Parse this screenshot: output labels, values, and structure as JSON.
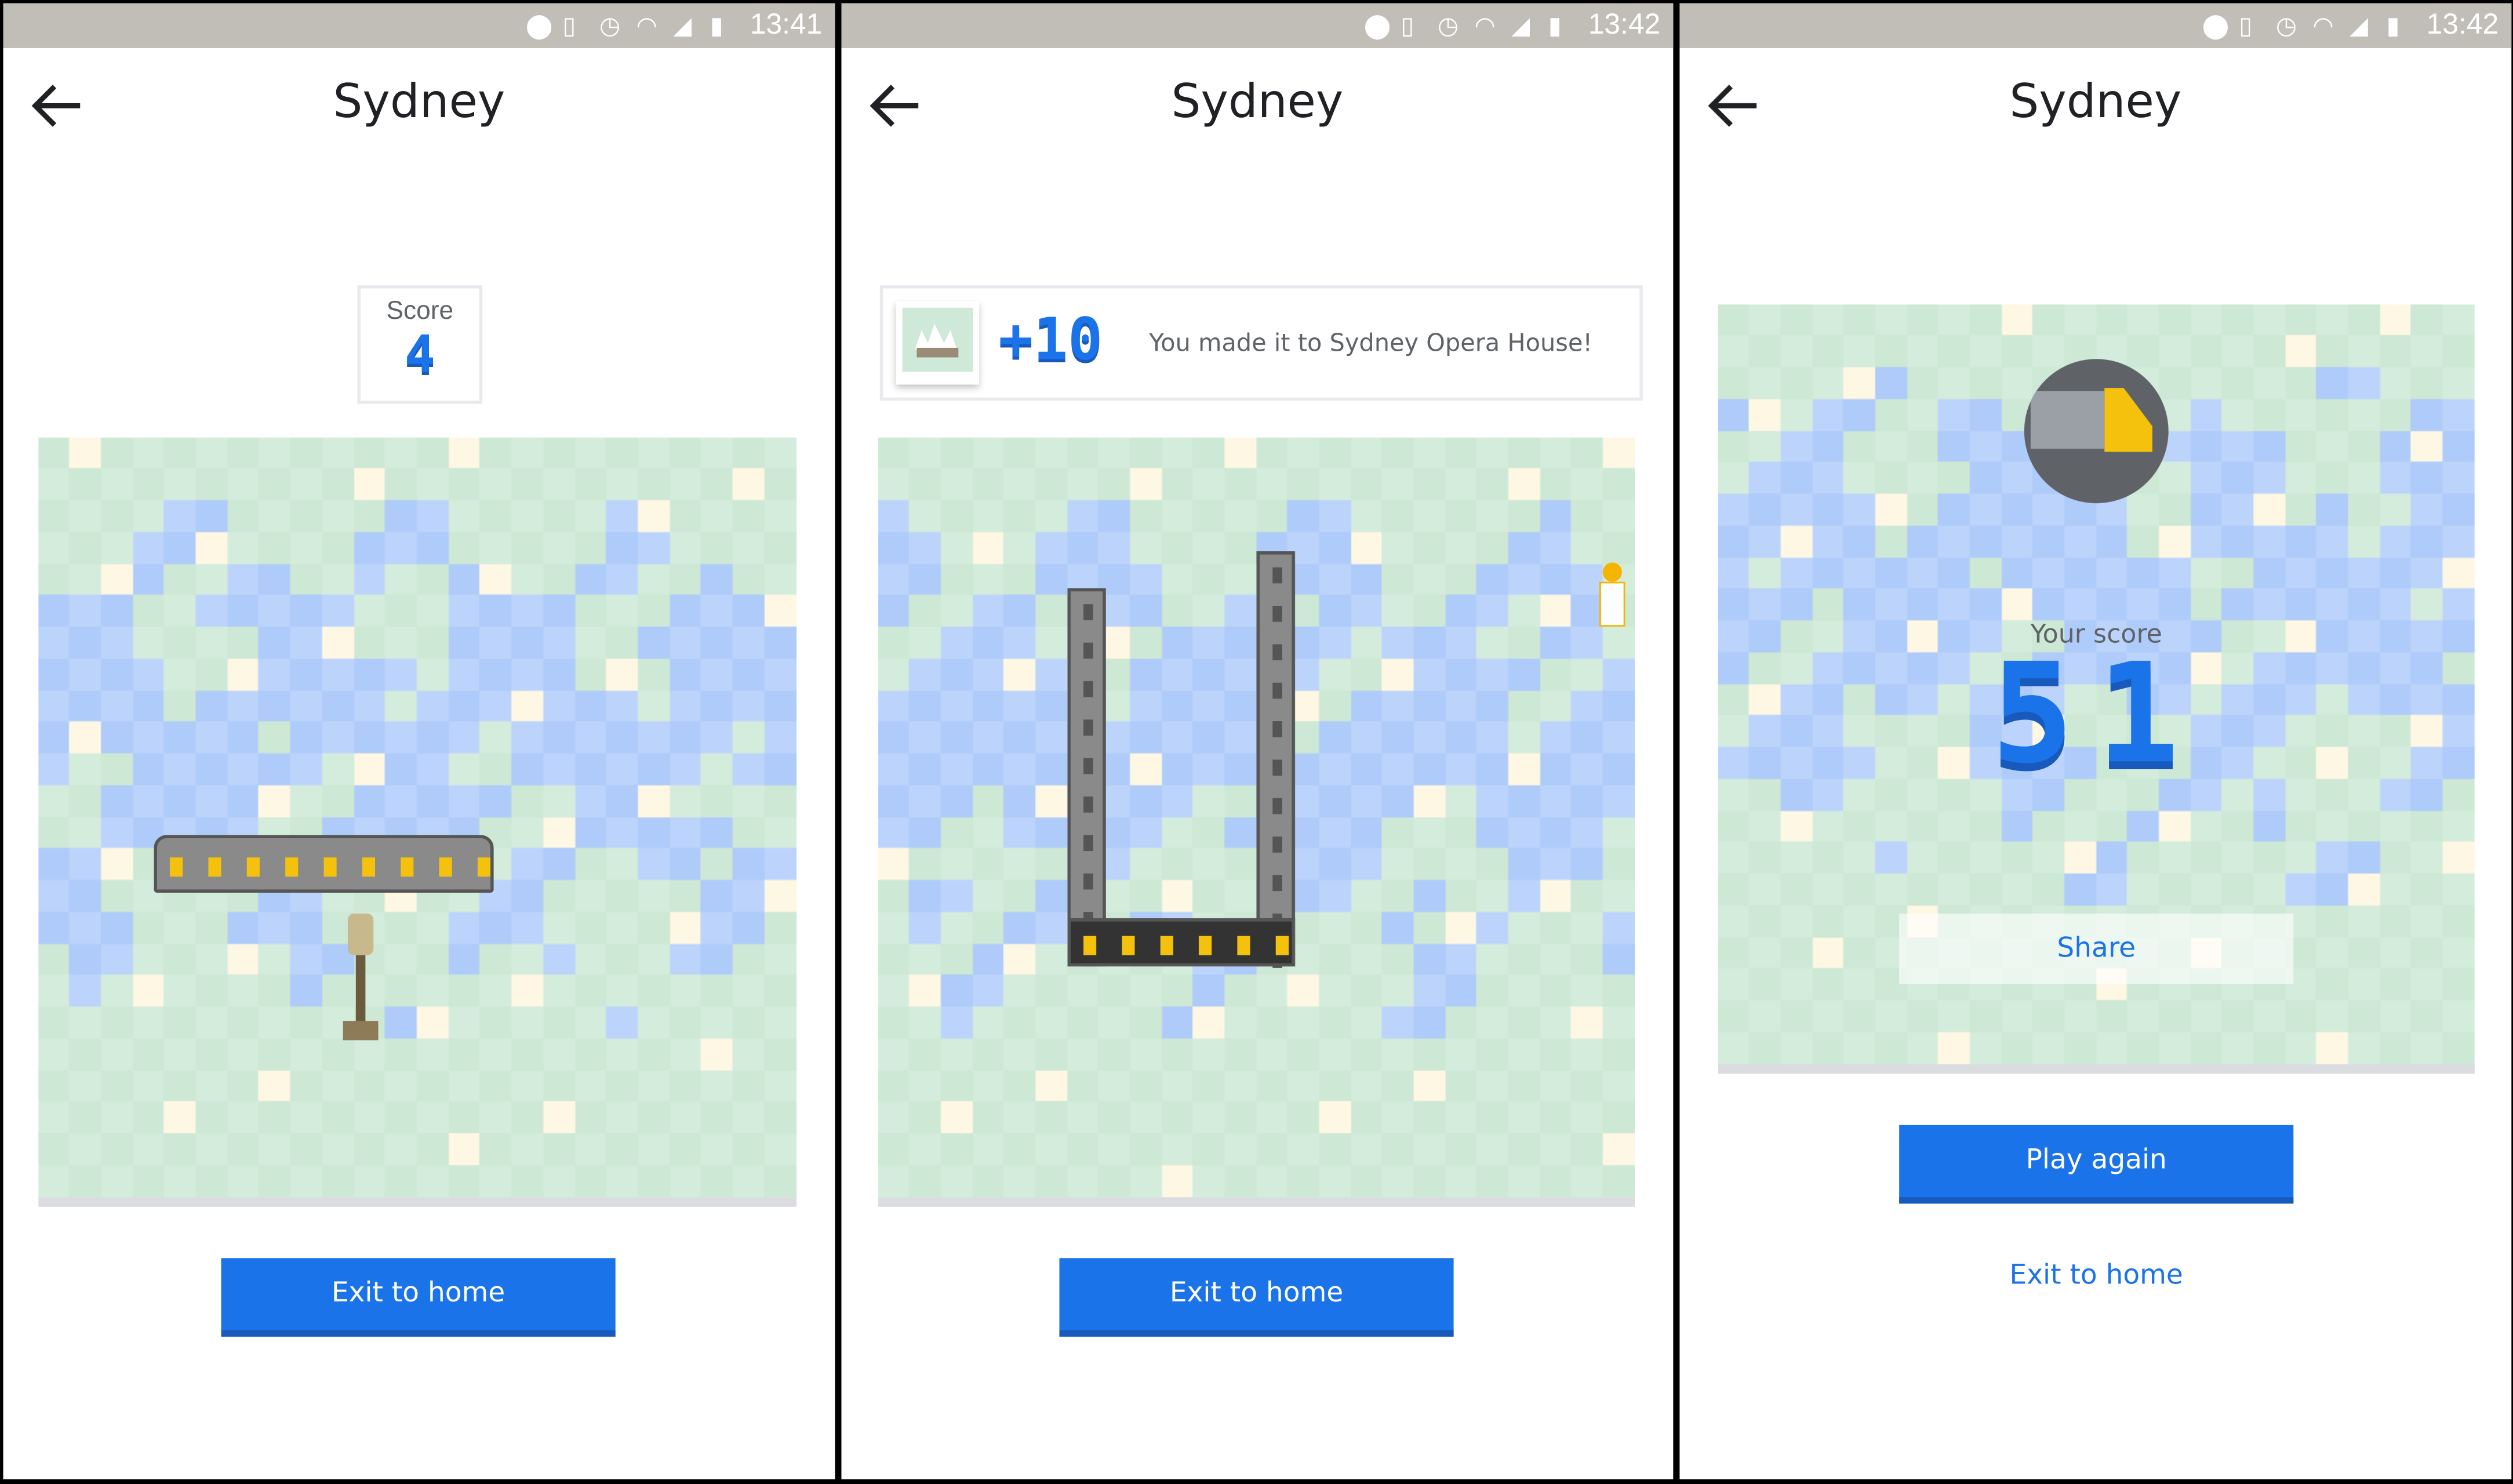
{
  "colors": {
    "accent": "#1a73e8",
    "accent_dark": "#185abc",
    "status_bar": "#c1beb7",
    "land_a": "#d4ecdb",
    "land_b": "#cde8d5",
    "water_a": "#aecbfa",
    "water_b": "#bcd4fb",
    "sand": "#fdf7e3"
  },
  "panels": [
    {
      "status": {
        "time": "13:41",
        "icons": [
          "location-icon",
          "vibrate-icon",
          "alarm-icon",
          "wifi-icon",
          "signal-icon",
          "battery-icon"
        ]
      },
      "title": "Sydney",
      "score": {
        "label": "Score",
        "value": "4"
      },
      "exit_label": "Exit to home"
    },
    {
      "status": {
        "time": "13:42",
        "icons": [
          "location-icon",
          "vibrate-icon",
          "alarm-icon",
          "wifi-icon",
          "signal-icon",
          "battery-icon"
        ]
      },
      "title": "Sydney",
      "banner": {
        "points": "+10",
        "message": "You made it to Sydney Opera House!"
      },
      "exit_label": "Exit to home"
    },
    {
      "status": {
        "time": "13:42",
        "icons": [
          "location-icon",
          "vibrate-icon",
          "alarm-icon",
          "wifi-icon",
          "signal-icon",
          "battery-icon"
        ]
      },
      "title": "Sydney",
      "final": {
        "label": "Your score",
        "value": "51",
        "share_label": "Share"
      },
      "play_again_label": "Play again",
      "exit_label": "Exit to home"
    }
  ]
}
